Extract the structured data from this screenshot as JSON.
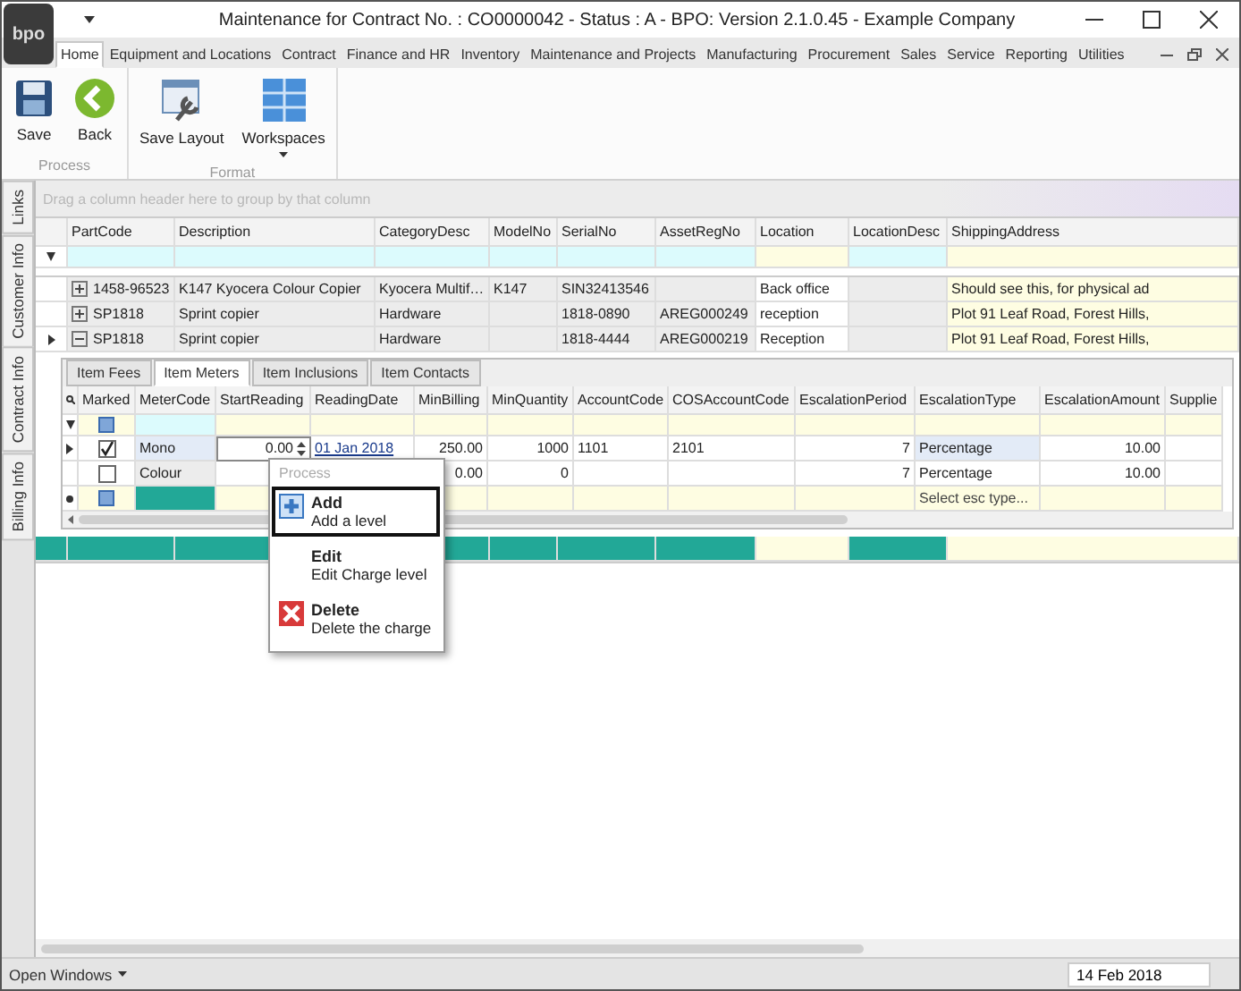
{
  "window": {
    "logo": "bpo",
    "title": "Maintenance for Contract No. : CO0000042 - Status : A - BPO: Version 2.1.0.45 - Example Company"
  },
  "ribbon_tabs": [
    {
      "label": "Home",
      "selected": true
    },
    {
      "label": "Equipment and Locations",
      "selected": false
    },
    {
      "label": "Contract",
      "selected": false
    },
    {
      "label": "Finance and HR",
      "selected": false
    },
    {
      "label": "Inventory",
      "selected": false
    },
    {
      "label": "Maintenance and Projects",
      "selected": false
    },
    {
      "label": "Manufacturing",
      "selected": false
    },
    {
      "label": "Procurement",
      "selected": false
    },
    {
      "label": "Sales",
      "selected": false
    },
    {
      "label": "Service",
      "selected": false
    },
    {
      "label": "Reporting",
      "selected": false
    },
    {
      "label": "Utilities",
      "selected": false
    }
  ],
  "ribbon_groups": [
    {
      "label": "Process",
      "buttons": [
        {
          "label": "Save",
          "kind": "save",
          "dropdown": false
        },
        {
          "label": "Back",
          "kind": "back",
          "dropdown": false
        }
      ]
    },
    {
      "label": "Format",
      "buttons": [
        {
          "label": "Save Layout",
          "kind": "layout",
          "dropdown": false
        },
        {
          "label": "Workspaces",
          "kind": "workspaces",
          "dropdown": true
        }
      ]
    }
  ],
  "side_tabs": [
    "Links",
    "Customer Info",
    "Contract Info",
    "Billing Info"
  ],
  "grid": {
    "group_hint": "Drag a column header here to group by that column",
    "columns": [
      "PartCode",
      "Description",
      "CategoryDesc",
      "ModelNo",
      "SerialNo",
      "AssetRegNo",
      "Location",
      "LocationDesc",
      "ShippingAddress"
    ],
    "rows": [
      {
        "expanded": false,
        "current": false,
        "cells": [
          "1458-96523",
          "K147 Kyocera Colour Copier",
          "Kyocera Multif…",
          "K147",
          "SIN32413546",
          "",
          "Back office",
          "",
          "Should see this, for physical ad"
        ]
      },
      {
        "expanded": false,
        "current": false,
        "cells": [
          "SP1818",
          "Sprint copier",
          "Hardware",
          "",
          "1818-0890",
          "AREG000249",
          "reception",
          "",
          "Plot 91 Leaf Road, Forest Hills,"
        ]
      },
      {
        "expanded": true,
        "current": true,
        "cells": [
          "SP1818",
          "Sprint copier",
          "Hardware",
          "",
          "1818-4444",
          "AREG000219",
          "Reception",
          "",
          "Plot 91 Leaf Road, Forest Hills,"
        ]
      }
    ]
  },
  "detail": {
    "tabs": [
      {
        "label": "Item Fees",
        "selected": false
      },
      {
        "label": "Item Meters",
        "selected": true
      },
      {
        "label": "Item Inclusions",
        "selected": false
      },
      {
        "label": "Item Contacts",
        "selected": false
      }
    ],
    "marked_column": "Marked",
    "columns": [
      "MeterCode",
      "StartReading",
      "ReadingDate",
      "MinBilling",
      "MinQuantity",
      "AccountCode",
      "COSAccountCode",
      "EscalationPeriod",
      "EscalationType",
      "EscalationAmount",
      "Supplie"
    ],
    "rows": [
      {
        "current": true,
        "marked": true,
        "cells": [
          "Mono",
          "0.00",
          "01 Jan 2018",
          "250.00",
          "1000",
          "1101",
          "2101",
          "7",
          "Percentage",
          "10.00",
          ""
        ]
      },
      {
        "current": false,
        "marked": false,
        "cells": [
          "Colour",
          "",
          "",
          "0.00",
          "0",
          "",
          "",
          "7",
          "Percentage",
          "10.00",
          ""
        ]
      }
    ],
    "new_row_placeholder": "Select esc type..."
  },
  "context_menu": {
    "header": "Process",
    "items": [
      {
        "kind": "add",
        "title": "Add",
        "subtitle": "Add a level",
        "selected": true
      },
      {
        "kind": "edit",
        "title": "Edit",
        "subtitle": "Edit Charge level",
        "selected": false
      },
      {
        "kind": "delete",
        "title": "Delete",
        "subtitle": "Delete the charge",
        "selected": false
      }
    ]
  },
  "status_bar": {
    "open_windows": "Open Windows",
    "date": "14 Feb 2018"
  }
}
